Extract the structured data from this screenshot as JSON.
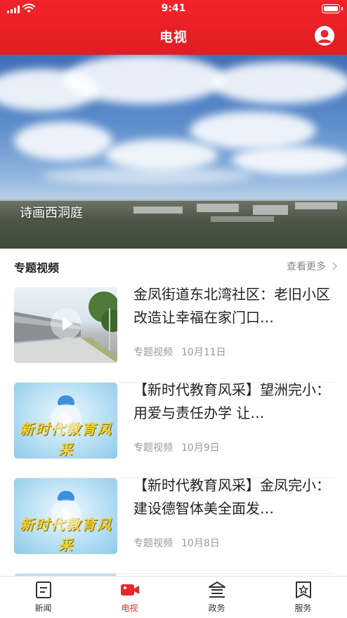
{
  "status_bar": {
    "time": "9:41"
  },
  "header": {
    "title": "电视",
    "avatar_icon": "user-avatar-icon"
  },
  "hero": {
    "caption": "诗画西洞庭"
  },
  "section": {
    "title": "专题视频",
    "more_label": "查看更多"
  },
  "videos": [
    {
      "title": "金凤街道东北湾社区：老旧小区改造让幸福在家门口…",
      "category": "专题视频",
      "date": "10月11日",
      "thumb": "road-scene"
    },
    {
      "title": "【新时代教育风采】望洲完小：用爱与责任办学 让…",
      "category": "专题视频",
      "date": "10月9日",
      "thumb": "education-banner"
    },
    {
      "title": "【新时代教育风采】金凤完小：建设德智体美全面发…",
      "category": "专题视频",
      "date": "10月8日",
      "thumb": "education-banner"
    }
  ],
  "thumb_text": {
    "edu_title": "新时代教育风采"
  },
  "tabbar": {
    "items": [
      {
        "label": "新闻",
        "icon": "news-icon"
      },
      {
        "label": "电视",
        "icon": "tv-camera-icon",
        "active": true
      },
      {
        "label": "政务",
        "icon": "government-icon"
      },
      {
        "label": "服务",
        "icon": "service-icon"
      }
    ]
  },
  "colors": {
    "brand_red": "#e8262b",
    "meta_gray": "#9a9a9a"
  }
}
